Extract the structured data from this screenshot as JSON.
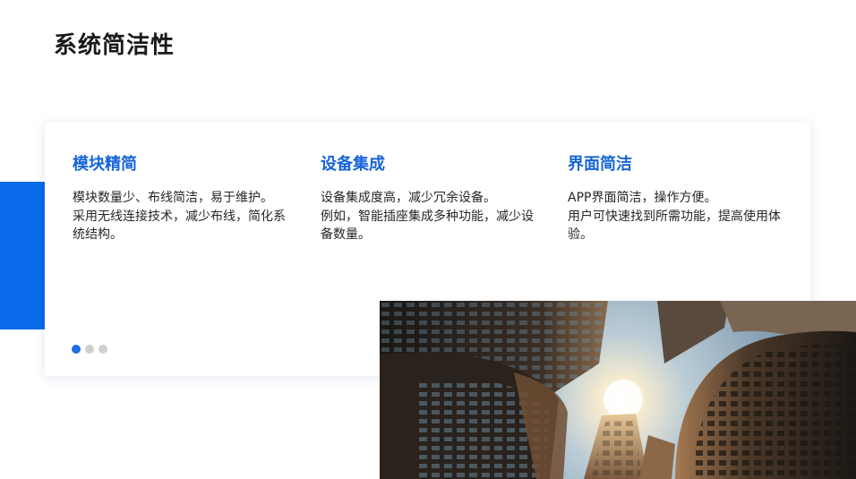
{
  "page": {
    "title": "系统简洁性"
  },
  "features": [
    {
      "title": "模块精简",
      "lines": [
        "模块数量少、布线简洁，易于维护。",
        "采用无线连接技术，减少布线，简化系",
        "统结构。"
      ]
    },
    {
      "title": "设备集成",
      "lines": [
        "设备集成度高，减少冗余设备。",
        "例如，智能插座集成多种功能，减少设",
        "备数量。"
      ]
    },
    {
      "title": "界面简洁",
      "lines": [
        "APP界面简洁，操作方便。",
        "用户可快速找到所需功能，提高使用体",
        "验。"
      ]
    }
  ],
  "carousel": {
    "dot_count": 3,
    "active_index": 0
  },
  "colors": {
    "accent": "#0a6bea",
    "feature_title": "#1765d8",
    "active_dot": "#1b6fe0",
    "inactive_dot": "#cfcfcf"
  }
}
